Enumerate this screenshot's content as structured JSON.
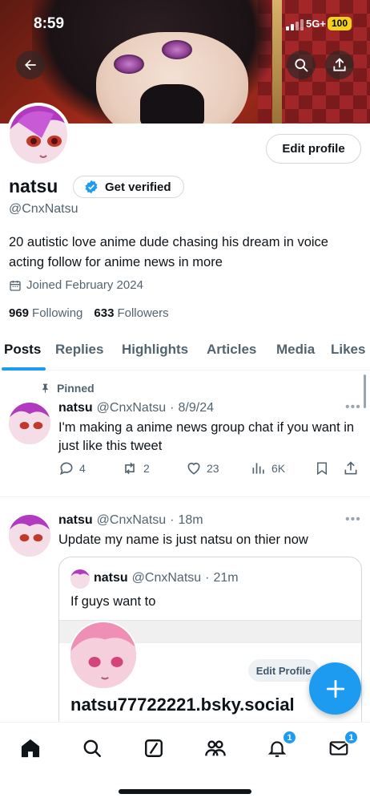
{
  "status_bar": {
    "time": "8:59",
    "network": "5G+",
    "battery": "100"
  },
  "header": {
    "back_icon": "arrow-left-icon",
    "search_icon": "search-icon",
    "share_icon": "share-upload-icon"
  },
  "profile": {
    "edit_label": "Edit profile",
    "name": "natsu",
    "verify_label": "Get verified",
    "handle": "@CnxNatsu",
    "bio": "20 autistic love anime dude chasing his dream in voice acting follow for anime news in more",
    "joined": "Joined February 2024",
    "following_count": "969",
    "following_label": "Following",
    "followers_count": "633",
    "followers_label": "Followers"
  },
  "tabs": [
    "Posts",
    "Replies",
    "Highlights",
    "Articles",
    "Media",
    "Likes"
  ],
  "posts": [
    {
      "pinned_label": "Pinned",
      "name": "natsu",
      "handle": "@CnxNatsu",
      "time": "8/9/24",
      "text": "I'm making a anime news group chat if you want in just like this tweet",
      "replies": "4",
      "reposts": "2",
      "likes": "23",
      "views": "6K"
    },
    {
      "name": "natsu",
      "handle": "@CnxNatsu",
      "time": "18m",
      "text": "Update my name is just natsu on thier now",
      "quote": {
        "name": "natsu",
        "handle": "@CnxNatsu",
        "time": "21m",
        "text": "If guys want to",
        "media_edit_label": "Edit Profile",
        "media_handle": "natsu77722221.bsky.social"
      }
    }
  ],
  "nav": {
    "notifications_badge": "1",
    "messages_badge": "1"
  },
  "colors": {
    "accent": "#1d9bf0",
    "text": "#0f1419",
    "secondary": "#536471"
  }
}
